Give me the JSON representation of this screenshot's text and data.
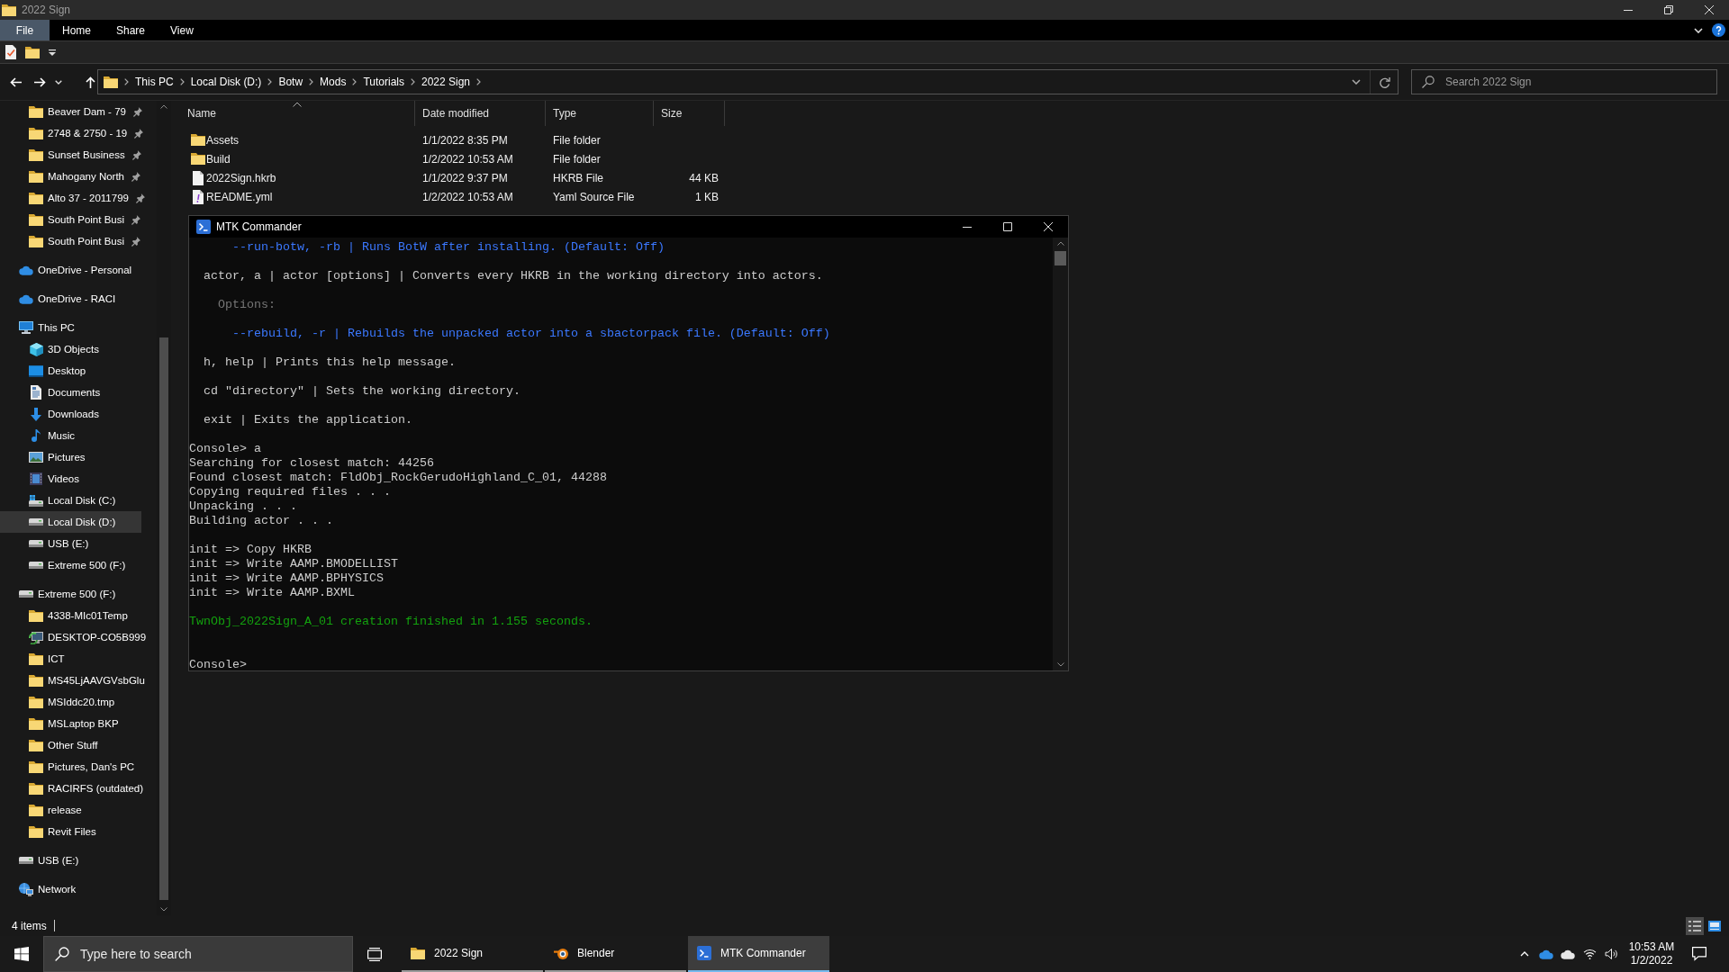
{
  "explorer": {
    "title": "2022 Sign",
    "ribbon_tabs": [
      {
        "label": "File",
        "selected": true
      },
      {
        "label": "Home",
        "selected": false
      },
      {
        "label": "Share",
        "selected": false
      },
      {
        "label": "View",
        "selected": false
      }
    ],
    "address": {
      "path": [
        "This PC",
        "Local Disk (D:)",
        "Botw",
        "Mods",
        "Tutorials",
        "2022 Sign"
      ]
    },
    "search": {
      "placeholder": "Search 2022 Sign"
    },
    "sidebar": {
      "quick_access": [
        {
          "label": "Beaver Dam - 79",
          "kind": "folder",
          "pinned": true,
          "selected": false
        },
        {
          "label": "2748 & 2750 - 19",
          "kind": "folder",
          "pinned": true,
          "selected": false
        },
        {
          "label": "Sunset Business",
          "kind": "folder",
          "pinned": true,
          "selected": false
        },
        {
          "label": "Mahogany North",
          "kind": "folder",
          "pinned": true,
          "selected": false
        },
        {
          "label": "Alto 37 - 2011799",
          "kind": "folder",
          "pinned": true,
          "selected": false
        },
        {
          "label": "South Point Busi",
          "kind": "folder",
          "pinned": true,
          "selected": false
        },
        {
          "label": "South Point Busi",
          "kind": "folder",
          "pinned": true,
          "selected": false
        }
      ],
      "items": [
        {
          "label": "OneDrive - Personal",
          "kind": "cloud",
          "selected": false
        },
        {
          "label": "OneDrive - RACI",
          "kind": "cloud",
          "selected": false
        },
        {
          "label": "This PC",
          "kind": "computer",
          "selected": false,
          "children": [
            {
              "label": "3D Objects",
              "kind": "cube",
              "selected": false
            },
            {
              "label": "Desktop",
              "kind": "desktop",
              "selected": false
            },
            {
              "label": "Documents",
              "kind": "documents",
              "selected": false
            },
            {
              "label": "Downloads",
              "kind": "downloads",
              "selected": false
            },
            {
              "label": "Music",
              "kind": "music",
              "selected": false
            },
            {
              "label": "Pictures",
              "kind": "pictures",
              "selected": false
            },
            {
              "label": "Videos",
              "kind": "videos",
              "selected": false
            },
            {
              "label": "Local Disk (C:)",
              "kind": "system-drive",
              "selected": false
            },
            {
              "label": "Local Disk (D:)",
              "kind": "drive",
              "selected": true
            },
            {
              "label": "USB (E:)",
              "kind": "drive",
              "selected": false
            },
            {
              "label": "Extreme 500 (F:)",
              "kind": "drive",
              "selected": false
            }
          ]
        },
        {
          "label": "Extreme 500 (F:)",
          "kind": "drive",
          "selected": false,
          "children": [
            {
              "label": "4338-MIc01Temp",
              "kind": "folder",
              "selected": false
            },
            {
              "label": "DESKTOP-CO5B999",
              "kind": "network-computer",
              "selected": false
            },
            {
              "label": "ICT",
              "kind": "folder",
              "selected": false
            },
            {
              "label": "MS45LjAAVGVsbGlu",
              "kind": "folder",
              "selected": false
            },
            {
              "label": "MSIddc20.tmp",
              "kind": "folder",
              "selected": false
            },
            {
              "label": "MSLaptop BKP",
              "kind": "folder",
              "selected": false
            },
            {
              "label": "Other Stuff",
              "kind": "folder",
              "selected": false
            },
            {
              "label": "Pictures, Dan's PC",
              "kind": "folder",
              "selected": false
            },
            {
              "label": "RACIRFS (outdated)",
              "kind": "folder",
              "selected": false
            },
            {
              "label": "release",
              "kind": "folder",
              "selected": false
            },
            {
              "label": "Revit Files",
              "kind": "folder",
              "selected": false
            }
          ]
        },
        {
          "label": "USB (E:)",
          "kind": "drive",
          "selected": false
        },
        {
          "label": "Network",
          "kind": "network",
          "selected": false
        }
      ]
    },
    "file_list": {
      "columns": [
        {
          "label": "Name",
          "sorted": true
        },
        {
          "label": "Date modified",
          "sorted": false
        },
        {
          "label": "Type",
          "sorted": false
        },
        {
          "label": "Size",
          "sorted": false
        }
      ],
      "rows": [
        {
          "kind": "folder",
          "name": "Assets",
          "date_modified": "1/1/2022 8:35 PM",
          "type": "File folder"
        },
        {
          "kind": "folder",
          "name": "Build",
          "date_modified": "1/2/2022 10:53 AM",
          "type": "File folder"
        },
        {
          "kind": "file",
          "name": "2022Sign.hkrb",
          "date_modified": "1/1/2022 9:37 PM",
          "type": "HKRB File",
          "size": "44 KB"
        },
        {
          "kind": "yaml",
          "name": "README.yml",
          "date_modified": "1/2/2022 10:53 AM",
          "type": "Yaml Source File",
          "size": "1 KB"
        }
      ]
    },
    "status_bar": {
      "item_count": "4 items",
      "views": [
        {
          "kind": "details",
          "selected": true
        },
        {
          "kind": "tiles",
          "selected": false
        }
      ]
    }
  },
  "console_window": {
    "title": "MTK Commander",
    "groups": [
      {
        "lines": [
          {
            "kind": "option",
            "text": "--run-botw, -rb | Runs BotW after installing. (Default: Off)"
          }
        ]
      },
      {
        "lines": [
          {
            "kind": "command",
            "text": "actor, a | actor [options] | Converts every HKRB in the working directory into actors."
          }
        ]
      },
      {
        "lines": [
          {
            "kind": "heading",
            "text": "Options:"
          }
        ]
      },
      {
        "lines": [
          {
            "kind": "option",
            "text": "--rebuild, -r | Rebuilds the unpacked actor into a sbactorpack file. (Default: Off)"
          }
        ]
      },
      {
        "lines": [
          {
            "kind": "command",
            "text": "h, help | Prints this help message."
          }
        ]
      },
      {
        "lines": [
          {
            "kind": "command",
            "text": "cd \"directory\" | Sets the working directory."
          }
        ]
      },
      {
        "lines": [
          {
            "kind": "command",
            "text": "exit | Exits the application."
          }
        ]
      },
      {
        "lines": [
          {
            "kind": "output",
            "text": "Console> a"
          },
          {
            "kind": "output",
            "text": "Searching for closest match: 44256"
          },
          {
            "kind": "output",
            "text": "Found closest match: FldObj_RockGerudoHighland_C_01, 44288"
          },
          {
            "kind": "output",
            "text": "Copying required files . . ."
          },
          {
            "kind": "output",
            "text": "Unpacking . . ."
          },
          {
            "kind": "output",
            "text": "Building actor . . ."
          }
        ]
      },
      {
        "lines": [
          {
            "kind": "output",
            "text": "init => Copy HKRB"
          },
          {
            "kind": "output",
            "text": "init => Write AAMP.BMODELLIST"
          },
          {
            "kind": "output",
            "text": "init => Write AAMP.BPHYSICS"
          },
          {
            "kind": "output",
            "text": "init => Write AAMP.BXML"
          }
        ]
      },
      {
        "lines": [
          {
            "kind": "success",
            "text": "TwnObj_2022Sign_A_01 creation finished in 1.155 seconds."
          }
        ]
      }
    ],
    "prompt": "Console>"
  },
  "taskbar": {
    "search": {
      "placeholder": "Type here to search"
    },
    "apps": [
      {
        "label": "2022 Sign",
        "kind": "folder",
        "selected": false
      },
      {
        "label": "Blender",
        "kind": "blender",
        "selected": false
      },
      {
        "label": "MTK Commander",
        "kind": "terminal",
        "selected": true
      }
    ],
    "clock": {
      "time": "10:53 AM",
      "date": "1/2/2022"
    }
  }
}
